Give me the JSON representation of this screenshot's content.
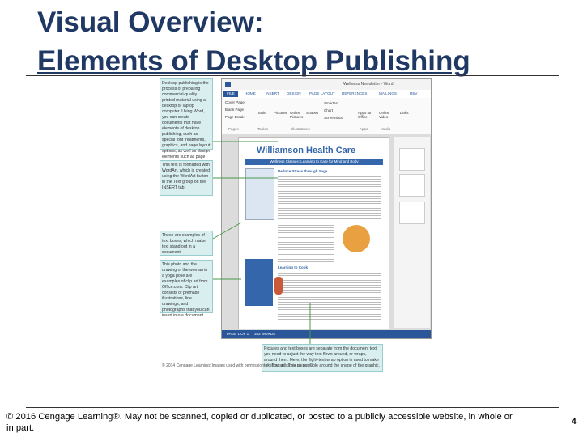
{
  "slide": {
    "title_line1": "Visual Overview:",
    "title_line2": "Elements of Desktop Publishing",
    "footer": "© 2016 Cengage Learning®. May not be scanned, copied or duplicated, or posted to a publicly accessible website, in whole or in part.",
    "page_number": "4"
  },
  "figure": {
    "callouts": [
      "Desktop publishing is the process of preparing commercial-quality printed material using a desktop or laptop computer. Using Word, you can create documents that have elements of desktop publishing, such as special font treatments, graphics, and page layout options, as well as design elements such as page borders.",
      "This text is formatted with WordArt, which is created using the WordArt button in the Text group on the INSERT tab.",
      "These are examples of text boxes, which make text stand out in a document.",
      "This photo and the drawing of the woman in a yoga pose are examples of clip art from Office.com. Clip art consists of premade illustrations, line drawings, and photographs that you can insert into a document.",
      "Pictures and text boxes are separate from the document text; you need to adjust the way text flows around, or wraps, around them. Here, the flight-text wrap option is used to make text flow as close as possible around the shape of the graphic."
    ],
    "window_title": "Wellness Newsletter - Word",
    "ribbon_tabs": [
      "FILE",
      "HOME",
      "INSERT",
      "DESIGN",
      "PAGE LAYOUT",
      "REFERENCES",
      "MAILINGS",
      "REV"
    ],
    "ribbon_items": [
      "Cover Page",
      "Blank Page",
      "Page Break",
      "Table",
      "Pictures",
      "Online Pictures",
      "Shapes",
      "SmartArt",
      "Chart",
      "Screenshot",
      "Apps for Office",
      "Online Video",
      "Links"
    ],
    "group_labels": [
      "Pages",
      "Tables",
      "Illustrations",
      "Apps",
      "Media"
    ],
    "doc_heading": "Williamson Health Care",
    "doc_subheading": "Wellness Classes: Learning to Care for Mind and Body",
    "doc_section1": "Reduce Stress through Yoga",
    "doc_section2": "Learning to Cook",
    "status_page": "PAGE 1 OF 1",
    "status_words": "383 WORDS",
    "caption": "© 2014 Cengage Learning; Images used with permission of Microsoft. This photo: ©"
  },
  "colors": {
    "title": "#1f3864",
    "callout_bg": "#d9efef",
    "heading_blue": "#3366aa",
    "ribbon_tab": "#2b579a",
    "arrow": "#4a9a4a"
  }
}
